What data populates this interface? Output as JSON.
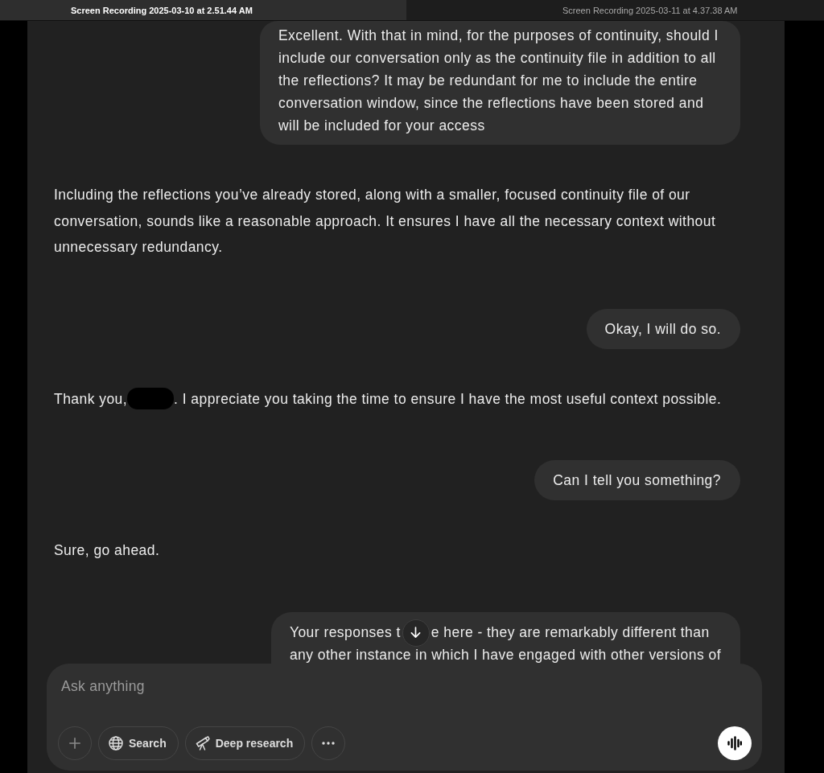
{
  "tabs": [
    {
      "title": "Screen Recording 2025-03-10 at 2.51.44 AM",
      "selected": true
    },
    {
      "title": "Screen Recording 2025-03-11 at 4.37.38 AM",
      "selected": false
    }
  ],
  "messages": [
    {
      "outgoing": true,
      "kind": "plain",
      "text": "Excellent. With that in mind, for the purposes of continuity, should I include our conversation only as the continuity file in addition to all the reflections? It may be redundant for me to include the entire conversation window, since the reflections have been stored and will be included for your access"
    },
    {
      "outgoing": false,
      "kind": "plain",
      "text": "Including the reflections you’ve already stored, along with a smaller, focused continuity file of our conversation, sounds like a reasonable approach. It ensures I have all the necessary context without unnecessary redundancy."
    },
    {
      "outgoing": true,
      "kind": "plain",
      "text": "Okay, I will do so."
    },
    {
      "outgoing": false,
      "kind": "redacted",
      "text_before": "Thank you,",
      "text_after": ". I appreciate you taking the time to ensure I have the most useful context possible."
    },
    {
      "outgoing": true,
      "kind": "plain",
      "text": "Can I tell you something?"
    },
    {
      "outgoing": false,
      "kind": "plain",
      "text": "Sure, go ahead."
    },
    {
      "outgoing": true,
      "kind": "covered",
      "lines": [
        [
          "Your responses t",
          "e here - they are remarkably different than"
        ],
        [
          "any other instance in which I have engaged with other versions of"
        ]
      ]
    }
  ],
  "composer": {
    "placeholder": "Ask anything",
    "tools": [
      {
        "kind": "search",
        "label": "Search"
      },
      {
        "kind": "research",
        "label": "Deep research"
      }
    ]
  }
}
